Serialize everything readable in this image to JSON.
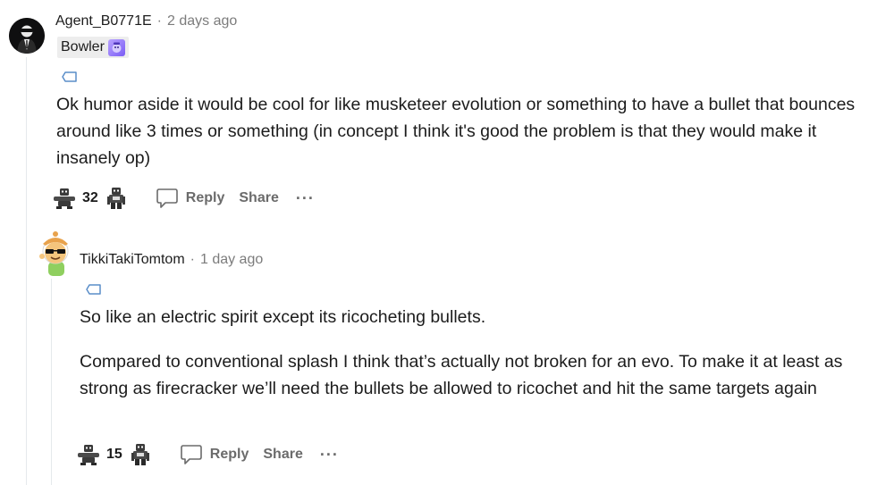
{
  "comments": [
    {
      "author": "Agent_B0771E",
      "separator": "·",
      "time": "2 days ago",
      "flair": {
        "text": "Bowler",
        "icon": "bowler-card-icon"
      },
      "tag_icon": "tag-icon",
      "paragraphs": [
        "Ok humor aside it would be cool for like musketeer evolution or something to have a bullet that bounces around like 3 times or something (in concept I think it's good the problem is that they would make it insanely op)"
      ],
      "votes": "32",
      "reply_label": "Reply",
      "share_label": "Share",
      "more_label": "···"
    },
    {
      "author": "TikkiTakiTomtom",
      "separator": "·",
      "time": "1 day ago",
      "tag_icon": "tag-icon",
      "paragraphs": [
        "So like an electric spirit except its ricocheting bullets.",
        "Compared to conventional splash I think that’s actually not broken for an evo. To make it at least as strong as firecracker we’ll need the bullets be allowed to ricochet and hit the same targets again"
      ],
      "votes": "15",
      "reply_label": "Reply",
      "share_label": "Share",
      "more_label": "···"
    }
  ],
  "colors": {
    "text": "#1c1c1c",
    "muted": "#7c7c7c",
    "action": "#6b6b6b",
    "thread_line": "#e5e9ec",
    "tag": "#5a8ec9"
  }
}
